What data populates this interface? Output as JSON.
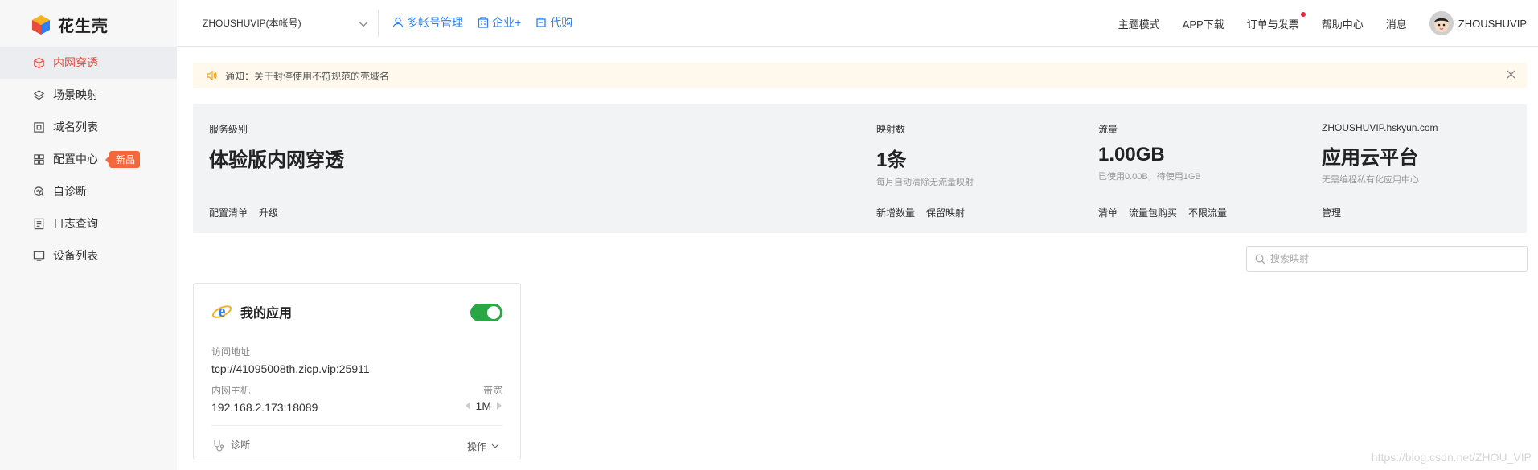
{
  "app": {
    "logo_text": "花生壳"
  },
  "sidebar": {
    "items": [
      {
        "label": "内网穿透",
        "icon": "cube-icon",
        "active": true
      },
      {
        "label": "场景映射",
        "icon": "layers-icon"
      },
      {
        "label": "域名列表",
        "icon": "domain-icon"
      },
      {
        "label": "配置中心",
        "icon": "grid-icon",
        "badge": "新品"
      },
      {
        "label": "自诊断",
        "icon": "diagnose-icon"
      },
      {
        "label": "日志查询",
        "icon": "log-icon"
      },
      {
        "label": "设备列表",
        "icon": "monitor-icon"
      }
    ]
  },
  "topbar": {
    "account": "ZHOUSHUVIP(本帐号)",
    "links": [
      {
        "label": "多帐号管理",
        "icon": "user-icon"
      },
      {
        "label": "企业+",
        "icon": "building-icon"
      },
      {
        "label": "代购",
        "icon": "cart-icon"
      }
    ],
    "right": {
      "theme": "主题模式",
      "app_download": "APP下载",
      "orders": "订单与发票",
      "help": "帮助中心",
      "messages": "消息",
      "username": "ZHOUSHUVIP"
    }
  },
  "notice": {
    "text": "通知：关于封停使用不符规范的壳域名"
  },
  "service": {
    "level": {
      "label": "服务级别",
      "value": "体验版内网穿透",
      "actions": [
        "配置清单",
        "升级"
      ]
    },
    "mappings": {
      "label": "映射数",
      "value": "1条",
      "sub": "每月自动清除无流量映射",
      "actions": [
        "新增数量",
        "保留映射"
      ]
    },
    "traffic": {
      "label": "流量",
      "value": "1.00GB",
      "sub": "已使用0.00B，待使用1GB",
      "actions": [
        "清单",
        "流量包购买",
        "不限流量"
      ]
    },
    "cloud": {
      "label": "ZHOUSHUVIP.hskyun.com",
      "value": "应用云平台",
      "sub": "无需编程私有化应用中心",
      "actions": [
        "管理"
      ]
    }
  },
  "search": {
    "placeholder": "搜索映射"
  },
  "card": {
    "title": "我的应用",
    "enabled": true,
    "address_label": "访问地址",
    "address": "tcp://41095008th.zicp.vip:25911",
    "host_label": "内网主机",
    "host": "192.168.2.173:18089",
    "bandwidth_label": "带宽",
    "bandwidth": "1M",
    "diagnose": "诊断",
    "operations": "操作"
  },
  "watermark": "https://blog.csdn.net/ZHOU_VIP"
}
